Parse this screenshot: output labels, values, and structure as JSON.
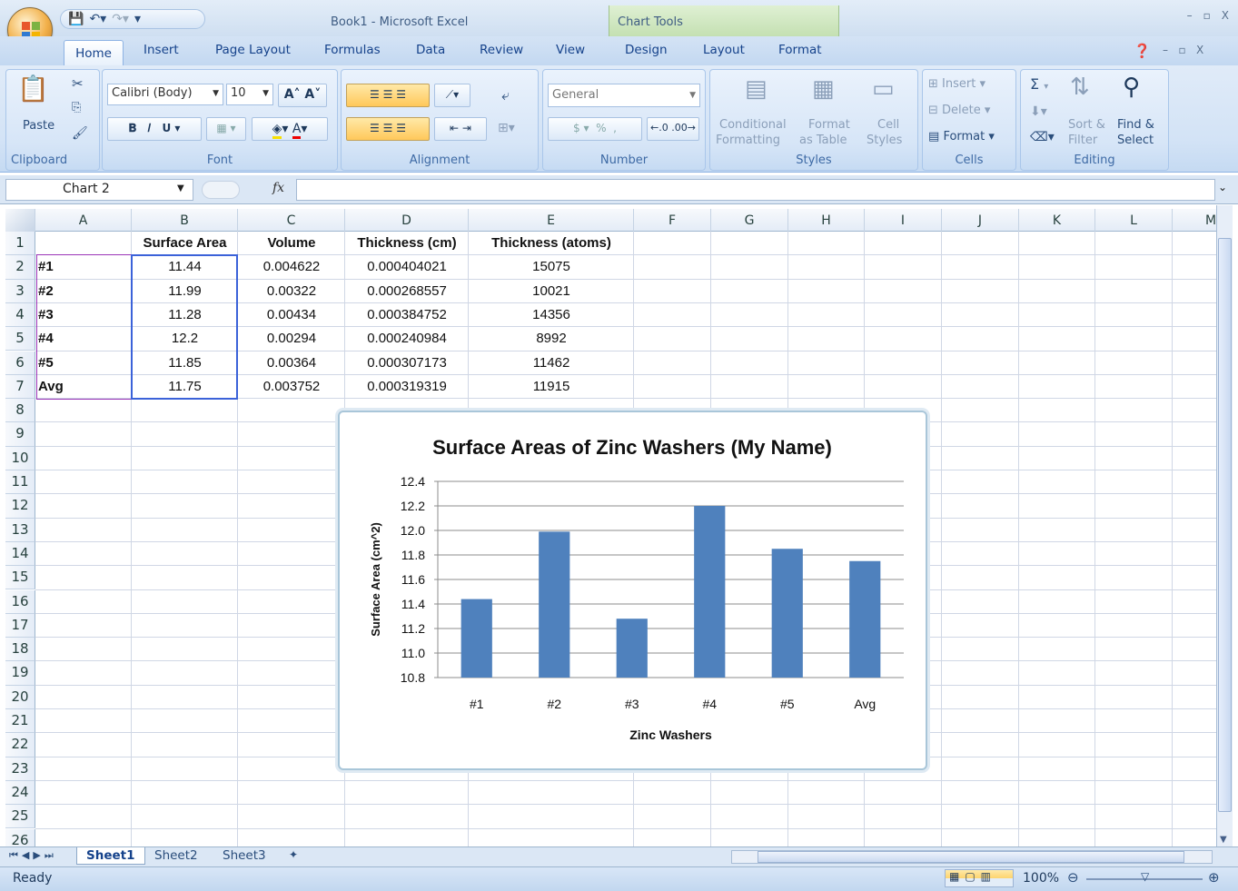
{
  "window": {
    "title": "Book1 - Microsoft Excel",
    "context_title": "Chart Tools",
    "controls": [
      "–",
      "▫",
      "X"
    ]
  },
  "tabs": [
    "Home",
    "Insert",
    "Page Layout",
    "Formulas",
    "Data",
    "Review",
    "View",
    "Design",
    "Layout",
    "Format"
  ],
  "ribbon": {
    "clipboard": {
      "paste": "Paste",
      "label": "Clipboard"
    },
    "font": {
      "name": "Calibri (Body)",
      "size": "10",
      "label": "Font"
    },
    "alignment": {
      "label": "Alignment"
    },
    "number": {
      "format": "General",
      "label": "Number",
      "currency": "$",
      "percent": "%",
      "comma": ","
    },
    "styles": {
      "conditional_1": "Conditional",
      "conditional_2": "Formatting",
      "table_1": "Format",
      "table_2": "as Table",
      "cell_1": "Cell",
      "cell_2": "Styles",
      "label": "Styles"
    },
    "cells": {
      "insert": "Insert",
      "delete": "Delete",
      "format": "Format",
      "label": "Cells"
    },
    "editing": {
      "sort_1": "Sort &",
      "sort_2": "Filter",
      "find_1": "Find &",
      "find_2": "Select",
      "label": "Editing",
      "sum": "Σ"
    }
  },
  "formula_bar": {
    "name_box": "Chart 2",
    "fx": "fx",
    "formula": ""
  },
  "columns": [
    "A",
    "B",
    "C",
    "D",
    "E",
    "F",
    "G",
    "H",
    "I",
    "J",
    "K",
    "L",
    "M"
  ],
  "rows": [
    "1",
    "2",
    "3",
    "4",
    "5",
    "6",
    "7",
    "8",
    "9",
    "10",
    "11",
    "12",
    "13",
    "14",
    "15",
    "16",
    "17",
    "18",
    "19",
    "20",
    "21",
    "22",
    "23",
    "24",
    "25",
    "26"
  ],
  "table": {
    "header": [
      "",
      "Surface Area",
      "Volume",
      "Thickness (cm)",
      "Thickness (atoms)"
    ],
    "rows": [
      [
        "#1",
        "11.44",
        "0.004622",
        "0.000404021",
        "15075"
      ],
      [
        "#2",
        "11.99",
        "0.00322",
        "0.000268557",
        "10021"
      ],
      [
        "#3",
        "11.28",
        "0.00434",
        "0.000384752",
        "14356"
      ],
      [
        "#4",
        "12.2",
        "0.00294",
        "0.000240984",
        "8992"
      ],
      [
        "#5",
        "11.85",
        "0.00364",
        "0.000307173",
        "11462"
      ],
      [
        "Avg",
        "11.75",
        "0.003752",
        "0.000319319",
        "11915"
      ]
    ]
  },
  "chart_data": {
    "type": "bar",
    "title": "Surface Areas of Zinc Washers (My Name)",
    "xlabel": "Zinc Washers",
    "ylabel": "Surface Area (cm^2)",
    "categories": [
      "#1",
      "#2",
      "#3",
      "#4",
      "#5",
      "Avg"
    ],
    "values": [
      11.44,
      11.99,
      11.28,
      12.2,
      11.85,
      11.75
    ],
    "ylim": [
      10.8,
      12.4
    ],
    "yticks": [
      "12.4",
      "12.2",
      "12.0",
      "11.8",
      "11.6",
      "11.4",
      "11.2",
      "11.0",
      "10.8"
    ],
    "grid": true,
    "legend": "none",
    "bar_color": "#4f81bd"
  },
  "sheets": [
    "Sheet1",
    "Sheet2",
    "Sheet3"
  ],
  "status": {
    "ready": "Ready",
    "zoom": "100%"
  }
}
